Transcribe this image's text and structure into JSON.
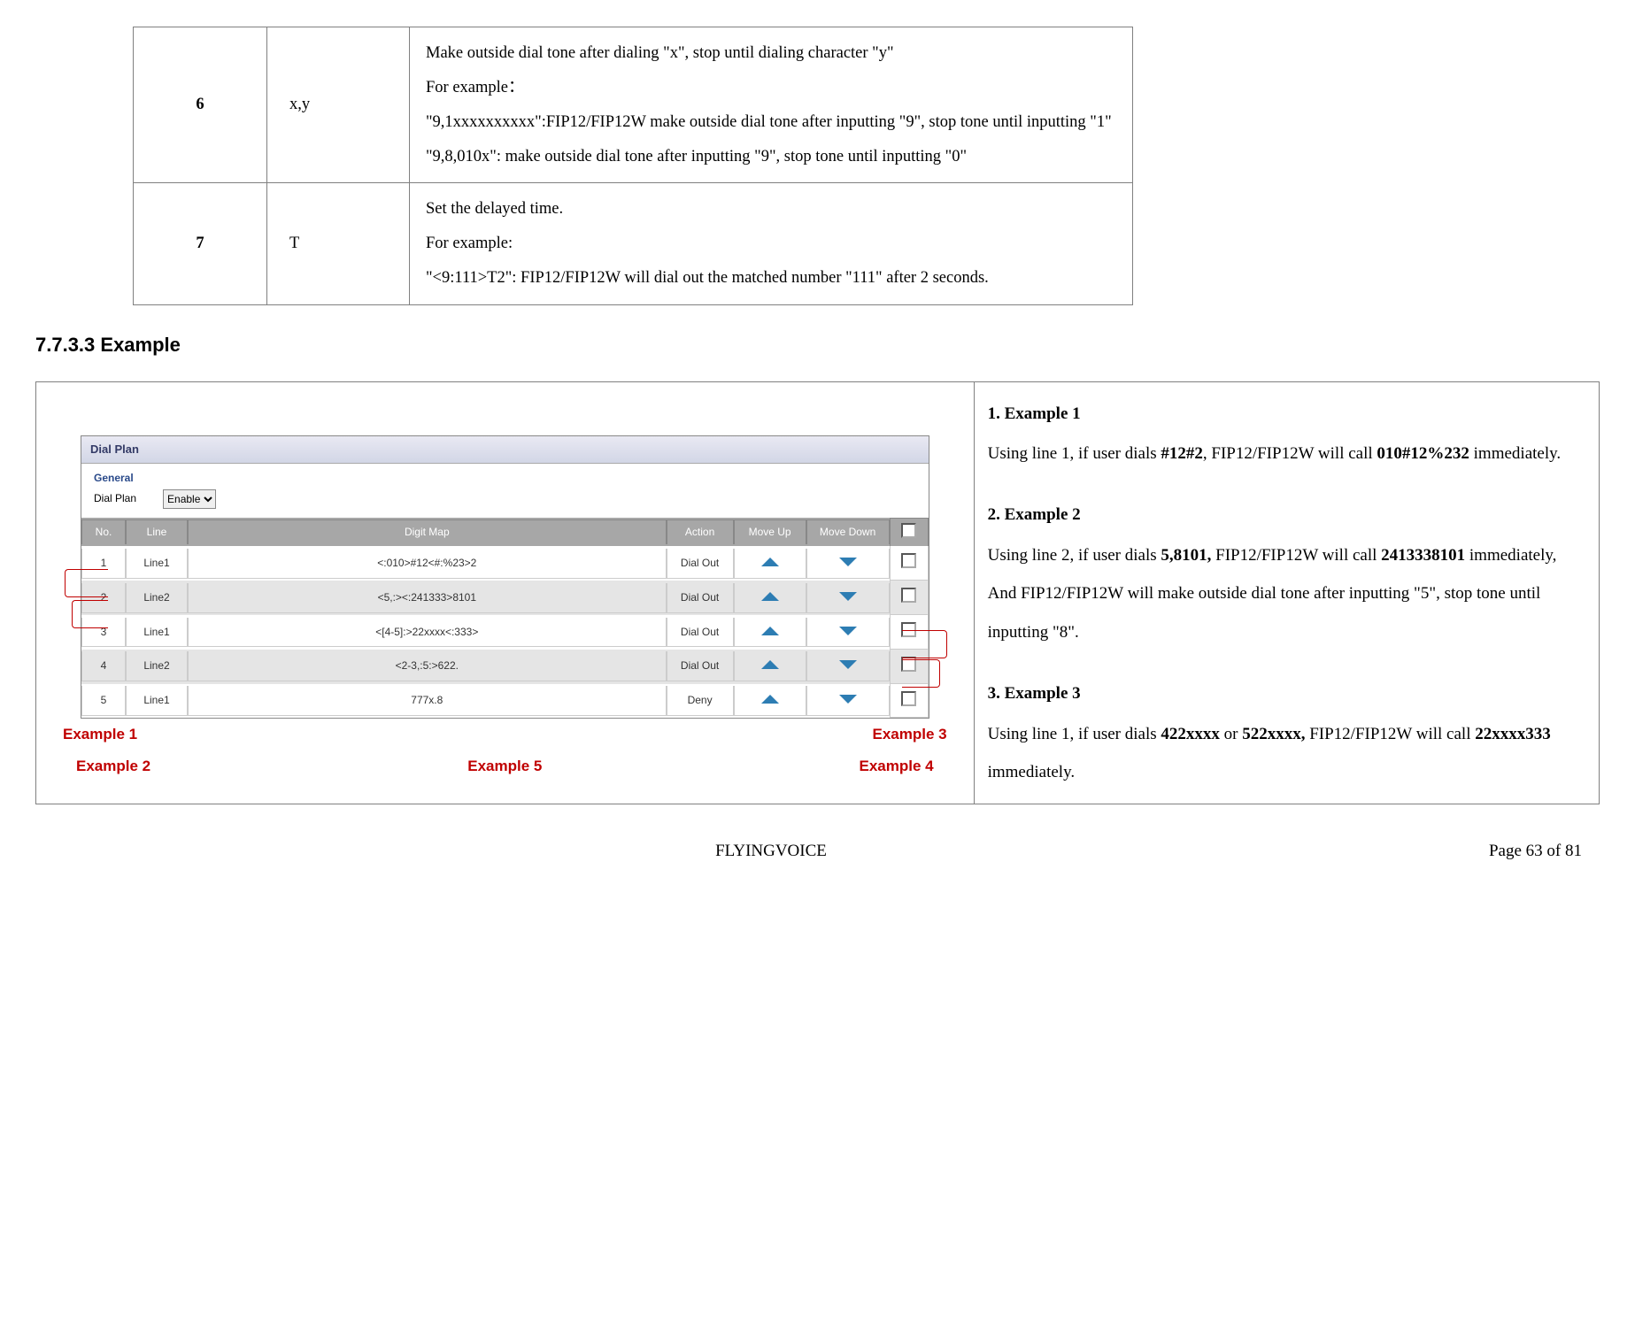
{
  "top_table": {
    "rows": [
      {
        "num": "6",
        "sym": "x,y",
        "desc": "Make outside dial tone after dialing \"x\", stop until dialing character \"y\"\nFor example：\n\"9,1xxxxxxxxxx\":FIP12/FIP12W make outside dial tone after inputting \"9\", stop tone until inputting \"1\"\n\"9,8,010x\": make outside dial tone after inputting \"9\", stop tone until inputting \"0\""
      },
      {
        "num": "7",
        "sym": "T",
        "desc": "Set the delayed time.\nFor example:\n\"<9:111>T2\": FIP12/FIP12W will dial out the matched number \"111\" after 2 seconds."
      }
    ]
  },
  "section_heading": "7.7.3.3  Example",
  "dialplan": {
    "title": "Dial Plan",
    "general_label": "General",
    "dialplan_label": "Dial Plan",
    "enable_value": "Enable",
    "headers": {
      "no": "No.",
      "line": "Line",
      "map": "Digit Map",
      "action": "Action",
      "up": "Move Up",
      "down": "Move Down"
    },
    "rows": [
      {
        "no": "1",
        "line": "Line1",
        "map": "<:010>#12<#:%23>2",
        "action": "Dial Out"
      },
      {
        "no": "2",
        "line": "Line2",
        "map": "<5,:><:241333>8101",
        "action": "Dial Out"
      },
      {
        "no": "3",
        "line": "Line1",
        "map": "<[4-5]:>22xxxx<:333>",
        "action": "Dial Out"
      },
      {
        "no": "4",
        "line": "Line2",
        "map": "<2-3,:5:>622.",
        "action": "Dial Out"
      },
      {
        "no": "5",
        "line": "Line1",
        "map": "777x.8",
        "action": "Deny"
      }
    ],
    "callouts": {
      "ex1": "Example 1",
      "ex2": "Example 2",
      "ex3": "Example 3",
      "ex4": "Example 4",
      "ex5": "Example 5"
    }
  },
  "right": {
    "h1": "1.   Example 1",
    "p1a": "Using line 1, if user dials ",
    "p1b": "#12#2",
    "p1c": ", FIP12/FIP12W will call ",
    "p1d": "010#12%232",
    "p1e": " immediately.",
    "h2": "2.   Example 2",
    "p2a": "Using line 2, if user dials ",
    "p2b": "5,8101,",
    "p2c": " FIP12/FIP12W will call ",
    "p2d": "2413338101",
    "p2e": " immediately,",
    "p2f": "And FIP12/FIP12W will make outside dial tone after inputting \"5\", stop tone until inputting \"8\".",
    "h3": "3.   Example 3",
    "p3a": "Using line 1, if user dials ",
    "p3b": "422xxxx",
    "p3c": " or ",
    "p3d": "522xxxx,",
    "p3e": " FIP12/FIP12W will call ",
    "p3f": "22xxxx333",
    "p3g": " immediately."
  },
  "footer": {
    "brand": "FLYINGVOICE",
    "page": "Page  63  of  81"
  }
}
